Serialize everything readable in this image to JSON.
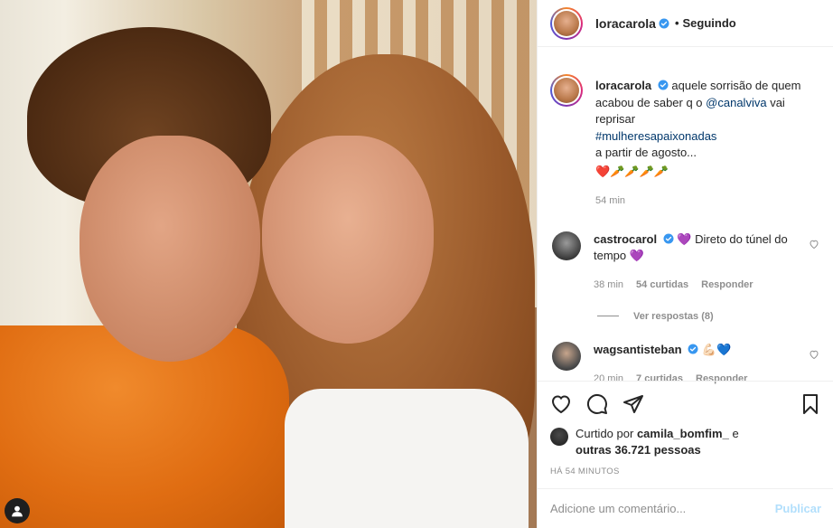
{
  "post": {
    "username": "loracarola",
    "follow_status": "Seguindo",
    "separator": "•"
  },
  "caption": {
    "username": "loracarola",
    "text_1": "aquele sorrisão de quem acabou de saber q o",
    "mention": "@canalviva",
    "text_2": "vai reprisar",
    "hashtag": "#mulheresapaixonadas",
    "text_3": "a partir de agosto...",
    "emojis": "❤️🥕🥕🥕🥕",
    "time": "54 min"
  },
  "comments": [
    {
      "username": "castrocarol",
      "text": "💜 Direto do túnel do tempo 💜",
      "time": "38 min",
      "likes": "54 curtidas",
      "reply": "Responder"
    },
    {
      "username": "wagsantisteban",
      "text": "💪🏻💙",
      "time": "20 min",
      "likes": "7 curtidas",
      "reply": "Responder"
    }
  ],
  "view_replies": "Ver respostas (8)",
  "likes": {
    "prefix": "Curtido por",
    "user": "camila_bomfim_",
    "mid": "e",
    "others": "outras 36.721 pessoas"
  },
  "timestamp": "HÁ 54 MINUTOS",
  "add_comment": {
    "placeholder": "Adicione um comentário...",
    "publish": "Publicar"
  },
  "colors": {
    "link": "#00376b",
    "verified": "#3897f0",
    "muted": "#8e8e8e",
    "publish_disabled": "#b2dffc"
  }
}
